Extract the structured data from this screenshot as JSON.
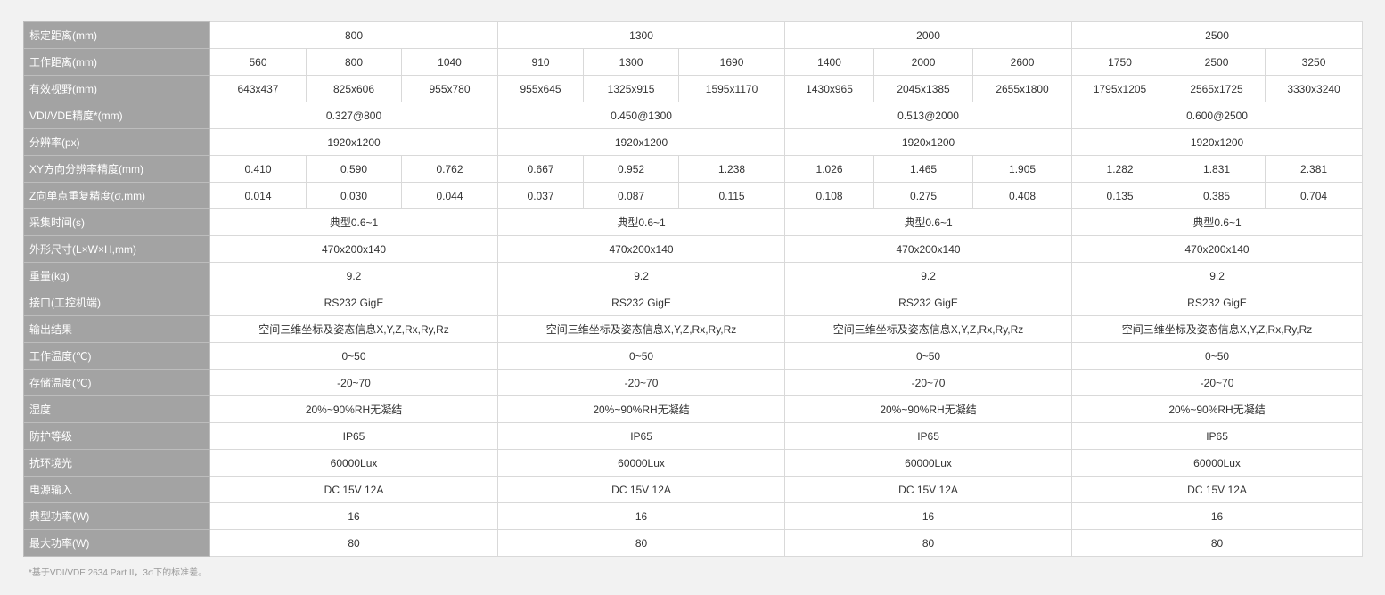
{
  "rows": [
    {
      "label": "标定距离(mm)",
      "cells": [
        {
          "text": "800",
          "span": 3
        },
        {
          "text": "1300",
          "span": 3
        },
        {
          "text": "2000",
          "span": 3
        },
        {
          "text": "2500",
          "span": 3
        }
      ]
    },
    {
      "label": "工作距离(mm)",
      "cells": [
        {
          "text": "560"
        },
        {
          "text": "800"
        },
        {
          "text": "1040"
        },
        {
          "text": "910"
        },
        {
          "text": "1300"
        },
        {
          "text": "1690"
        },
        {
          "text": "1400"
        },
        {
          "text": "2000"
        },
        {
          "text": "2600"
        },
        {
          "text": "1750"
        },
        {
          "text": "2500"
        },
        {
          "text": "3250"
        }
      ]
    },
    {
      "label": "有效视野(mm)",
      "cells": [
        {
          "text": "643x437"
        },
        {
          "text": "825x606"
        },
        {
          "text": "955x780"
        },
        {
          "text": "955x645"
        },
        {
          "text": "1325x915"
        },
        {
          "text": "1595x1170"
        },
        {
          "text": "1430x965"
        },
        {
          "text": "2045x1385"
        },
        {
          "text": "2655x1800"
        },
        {
          "text": "1795x1205"
        },
        {
          "text": "2565x1725"
        },
        {
          "text": "3330x3240"
        }
      ]
    },
    {
      "label": "VDI/VDE精度*(mm)",
      "cells": [
        {
          "text": "0.327@800",
          "span": 3
        },
        {
          "text": "0.450@1300",
          "span": 3
        },
        {
          "text": "0.513@2000",
          "span": 3
        },
        {
          "text": "0.600@2500",
          "span": 3
        }
      ]
    },
    {
      "label": "分辨率(px)",
      "cells": [
        {
          "text": "1920x1200",
          "span": 3
        },
        {
          "text": "1920x1200",
          "span": 3
        },
        {
          "text": "1920x1200",
          "span": 3
        },
        {
          "text": "1920x1200",
          "span": 3
        }
      ]
    },
    {
      "label": "XY方向分辨率精度(mm)",
      "cells": [
        {
          "text": "0.410"
        },
        {
          "text": "0.590"
        },
        {
          "text": "0.762"
        },
        {
          "text": "0.667"
        },
        {
          "text": "0.952"
        },
        {
          "text": "1.238"
        },
        {
          "text": "1.026"
        },
        {
          "text": "1.465"
        },
        {
          "text": "1.905"
        },
        {
          "text": "1.282"
        },
        {
          "text": "1.831"
        },
        {
          "text": "2.381"
        }
      ]
    },
    {
      "label": "Z向单点重复精度(σ,mm)",
      "cells": [
        {
          "text": "0.014"
        },
        {
          "text": "0.030"
        },
        {
          "text": "0.044"
        },
        {
          "text": "0.037"
        },
        {
          "text": "0.087"
        },
        {
          "text": "0.115"
        },
        {
          "text": "0.108"
        },
        {
          "text": "0.275"
        },
        {
          "text": "0.408"
        },
        {
          "text": "0.135"
        },
        {
          "text": "0.385"
        },
        {
          "text": "0.704"
        }
      ]
    },
    {
      "label": "采集时间(s)",
      "cells": [
        {
          "text": "典型0.6~1",
          "span": 3
        },
        {
          "text": "典型0.6~1",
          "span": 3
        },
        {
          "text": "典型0.6~1",
          "span": 3
        },
        {
          "text": "典型0.6~1",
          "span": 3
        }
      ]
    },
    {
      "label": "外形尺寸(L×W×H,mm)",
      "cells": [
        {
          "text": "470x200x140",
          "span": 3
        },
        {
          "text": "470x200x140",
          "span": 3
        },
        {
          "text": "470x200x140",
          "span": 3
        },
        {
          "text": "470x200x140",
          "span": 3
        }
      ]
    },
    {
      "label": "重量(kg)",
      "cells": [
        {
          "text": "9.2",
          "span": 3
        },
        {
          "text": "9.2",
          "span": 3
        },
        {
          "text": "9.2",
          "span": 3
        },
        {
          "text": "9.2",
          "span": 3
        }
      ]
    },
    {
      "label": "接口(工控机端)",
      "cells": [
        {
          "text": "RS232 GigE",
          "span": 3
        },
        {
          "text": "RS232 GigE",
          "span": 3
        },
        {
          "text": "RS232 GigE",
          "span": 3
        },
        {
          "text": "RS232 GigE",
          "span": 3
        }
      ]
    },
    {
      "label": "输出结果",
      "cells": [
        {
          "text": "空间三维坐标及姿态信息X,Y,Z,Rx,Ry,Rz",
          "span": 3
        },
        {
          "text": "空间三维坐标及姿态信息X,Y,Z,Rx,Ry,Rz",
          "span": 3
        },
        {
          "text": "空间三维坐标及姿态信息X,Y,Z,Rx,Ry,Rz",
          "span": 3
        },
        {
          "text": "空间三维坐标及姿态信息X,Y,Z,Rx,Ry,Rz",
          "span": 3
        }
      ]
    },
    {
      "label": "工作温度(℃)",
      "cells": [
        {
          "text": "0~50",
          "span": 3
        },
        {
          "text": "0~50",
          "span": 3
        },
        {
          "text": "0~50",
          "span": 3
        },
        {
          "text": "0~50",
          "span": 3
        }
      ]
    },
    {
      "label": "存储温度(℃)",
      "cells": [
        {
          "text": "-20~70",
          "span": 3
        },
        {
          "text": "-20~70",
          "span": 3
        },
        {
          "text": "-20~70",
          "span": 3
        },
        {
          "text": "-20~70",
          "span": 3
        }
      ]
    },
    {
      "label": "湿度",
      "cells": [
        {
          "text": "20%~90%RH无凝结",
          "span": 3
        },
        {
          "text": "20%~90%RH无凝结",
          "span": 3
        },
        {
          "text": "20%~90%RH无凝结",
          "span": 3
        },
        {
          "text": "20%~90%RH无凝结",
          "span": 3
        }
      ]
    },
    {
      "label": "防护等级",
      "cells": [
        {
          "text": "IP65",
          "span": 3
        },
        {
          "text": "IP65",
          "span": 3
        },
        {
          "text": "IP65",
          "span": 3
        },
        {
          "text": "IP65",
          "span": 3
        }
      ]
    },
    {
      "label": "抗环境光",
      "cells": [
        {
          "text": "60000Lux",
          "span": 3
        },
        {
          "text": "60000Lux",
          "span": 3
        },
        {
          "text": "60000Lux",
          "span": 3
        },
        {
          "text": "60000Lux",
          "span": 3
        }
      ]
    },
    {
      "label": "电源输入",
      "cells": [
        {
          "text": "DC 15V 12A",
          "span": 3
        },
        {
          "text": "DC 15V 12A",
          "span": 3
        },
        {
          "text": "DC 15V 12A",
          "span": 3
        },
        {
          "text": "DC 15V 12A",
          "span": 3
        }
      ]
    },
    {
      "label": "典型功率(W)",
      "cells": [
        {
          "text": "16",
          "span": 3
        },
        {
          "text": "16",
          "span": 3
        },
        {
          "text": "16",
          "span": 3
        },
        {
          "text": "16",
          "span": 3
        }
      ]
    },
    {
      "label": "最大功率(W)",
      "cells": [
        {
          "text": "80",
          "span": 3
        },
        {
          "text": "80",
          "span": 3
        },
        {
          "text": "80",
          "span": 3
        },
        {
          "text": "80",
          "span": 3
        }
      ]
    }
  ],
  "footnote": "*基于VDI/VDE 2634 Part II，3σ下的标准差。",
  "colors": {
    "label_background": "#a3a3a3",
    "label_text": "#ffffff",
    "cell_background": "#ffffff",
    "cell_text": "#333333",
    "border": "#d9d9d9",
    "page_background": "#f2f2f2",
    "footnote_text": "#999999"
  }
}
